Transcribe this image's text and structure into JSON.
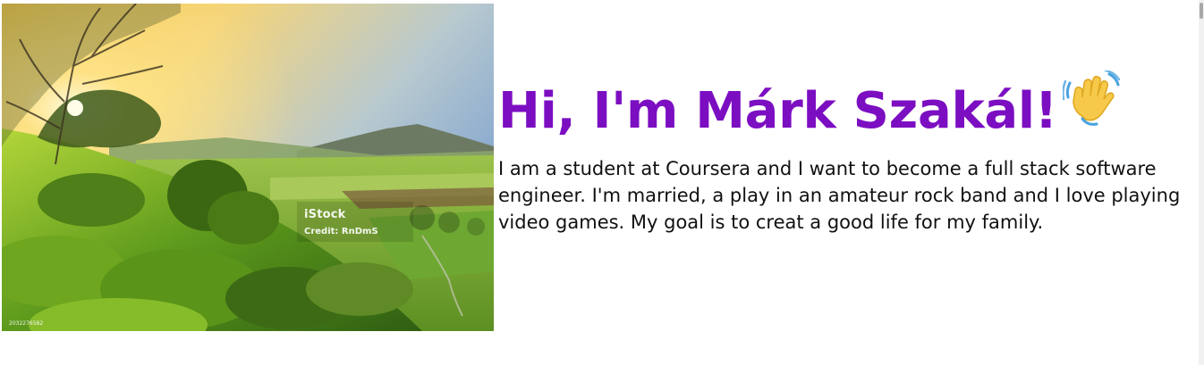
{
  "photo": {
    "watermark_brand": "iStock",
    "watermark_credit": "Credit: RnDmS",
    "image_id": "2032276582"
  },
  "intro": {
    "heading": "Hi, I'm Márk Szakál!",
    "wave_emoji": "waving-hand-icon",
    "bio": "I am a student at Coursera and I want to become a full stack software engineer. I'm married, a play in an amateur rock band and I love playing video games. My goal is to creat a good life for my family."
  },
  "colors": {
    "heading": "#7c0ec2",
    "text": "#111111",
    "background": "#ffffff"
  }
}
